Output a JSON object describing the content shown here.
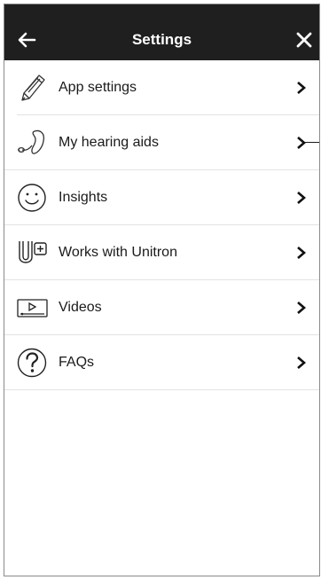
{
  "header": {
    "title": "Settings"
  },
  "items": [
    {
      "label": "App settings",
      "icon": "pencil-icon"
    },
    {
      "label": "My hearing aids",
      "icon": "hearing-aid-icon"
    },
    {
      "label": "Insights",
      "icon": "smiley-icon"
    },
    {
      "label": "Works with Unitron",
      "icon": "works-with-unitron-icon"
    },
    {
      "label": "Videos",
      "icon": "video-player-icon"
    },
    {
      "label": "FAQs",
      "icon": "question-icon"
    }
  ],
  "colors": {
    "header_bg": "#1f1f1f",
    "header_text": "#ffffff",
    "divider": "#e3e3e3",
    "text": "#1a1a1a"
  }
}
